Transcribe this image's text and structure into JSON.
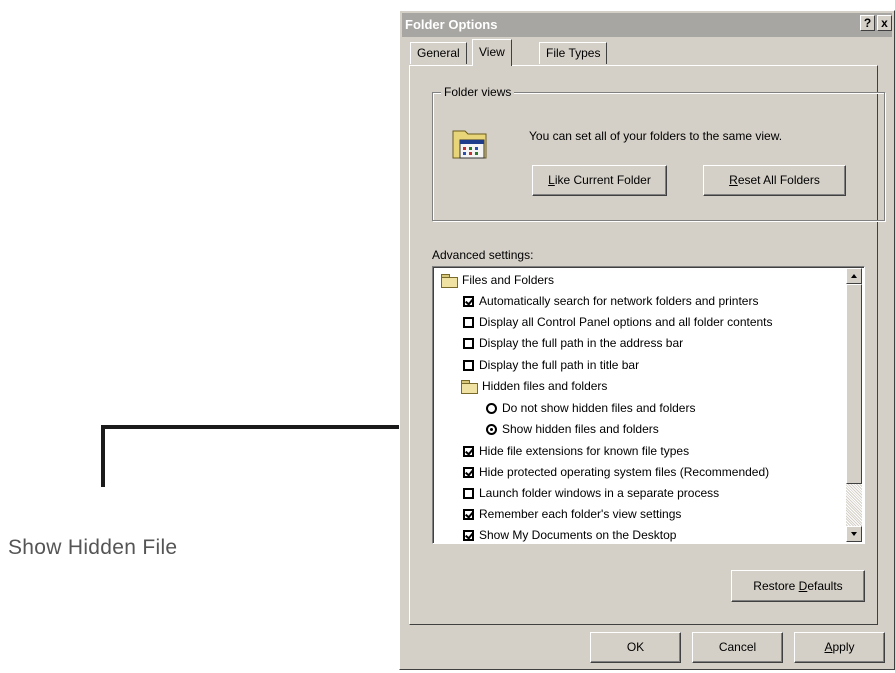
{
  "annotation": {
    "label": "Show Hidden File"
  },
  "dialog": {
    "title": "Folder Options",
    "help_glyph": "?",
    "close_glyph": "x",
    "tabs": [
      {
        "label": "General",
        "active": false
      },
      {
        "label": "View",
        "active": true
      },
      {
        "label": "File Types",
        "active": false
      }
    ],
    "folder_views": {
      "legend": "Folder views",
      "description": "You can set all of your folders to the same view.",
      "like_current_button": {
        "mnemonic": "L",
        "rest": "ike Current Folder"
      },
      "reset_all_button": {
        "mnemonic": "R",
        "rest": "eset All Folders"
      }
    },
    "advanced": {
      "label": "Advanced settings:",
      "items": [
        {
          "text": "Files and Folders",
          "type": "folder"
        },
        {
          "text": "Automatically search for network folders and printers",
          "type": "checkbox",
          "checked": true
        },
        {
          "text": "Display all Control Panel options and all folder contents",
          "type": "checkbox",
          "checked": false
        },
        {
          "text": "Display the full path in the address bar",
          "type": "checkbox",
          "checked": false
        },
        {
          "text": "Display the full path in title bar",
          "type": "checkbox",
          "checked": false
        },
        {
          "text": "Hidden files and folders",
          "type": "folder"
        },
        {
          "text": "Do not show hidden files and folders",
          "type": "radio",
          "checked": false
        },
        {
          "text": "Show hidden files and folders",
          "type": "radio",
          "checked": true
        },
        {
          "text": "Hide file extensions for known file types",
          "type": "checkbox",
          "checked": true
        },
        {
          "text": "Hide protected operating system files (Recommended)",
          "type": "checkbox",
          "checked": true
        },
        {
          "text": "Launch folder windows in a separate process",
          "type": "checkbox",
          "checked": false
        },
        {
          "text": "Remember each folder's view settings",
          "type": "checkbox",
          "checked": true
        },
        {
          "text": "Show My Documents on the Desktop",
          "type": "checkbox",
          "checked": true
        }
      ]
    },
    "restore_defaults_button": {
      "before": "Restore ",
      "mnemonic": "D",
      "after": "efaults"
    },
    "ok_label": "OK",
    "cancel_label": "Cancel",
    "apply_button": {
      "mnemonic": "A",
      "rest": "pply"
    }
  }
}
